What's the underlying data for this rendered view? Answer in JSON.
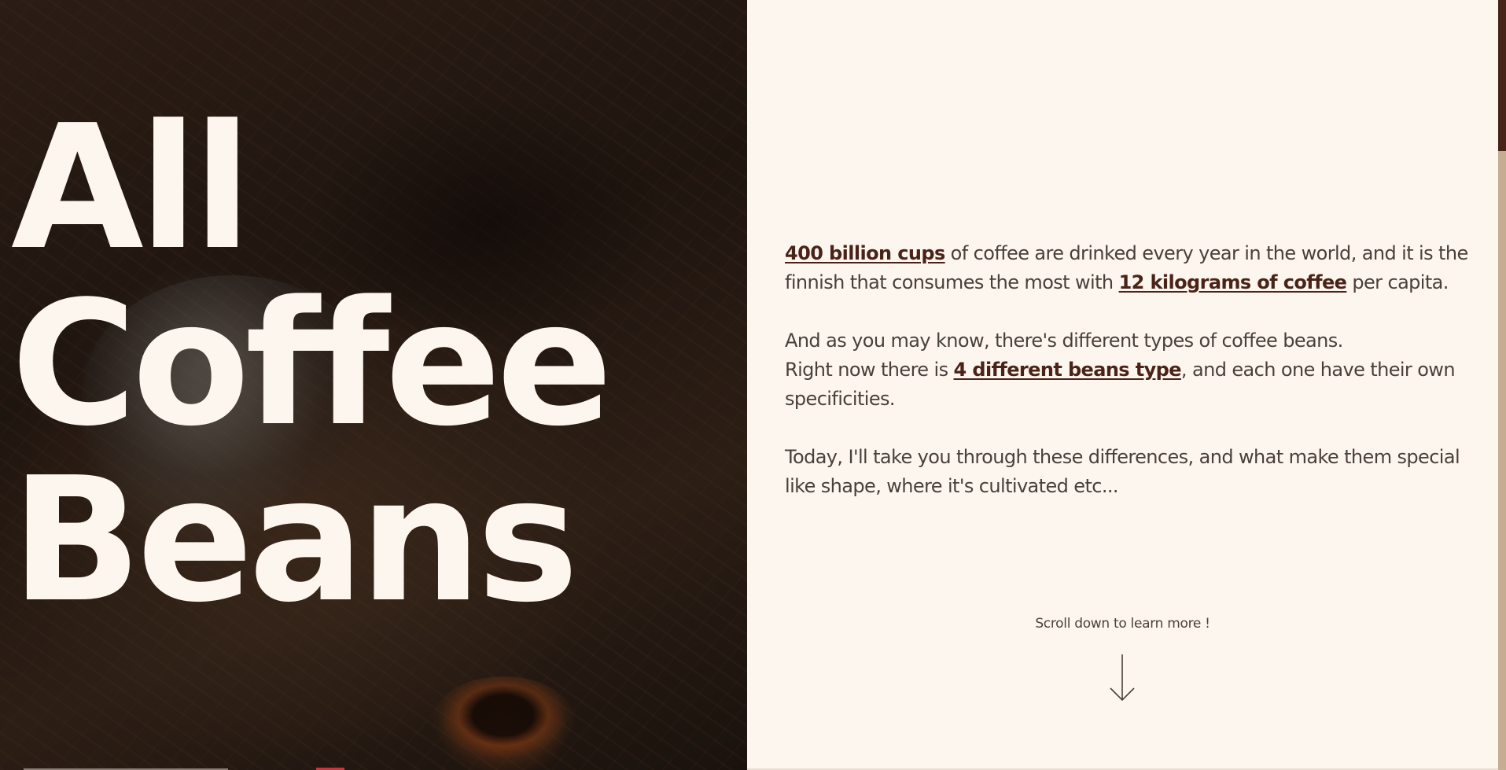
{
  "hero": {
    "title_lines": [
      "All",
      "Coffee",
      "Beans"
    ]
  },
  "intro": {
    "paragraph1": {
      "stat1": "400 billion cups",
      "text1": " of coffee are drinked every year in the world, and it is the finnish that consumes the most with ",
      "stat2": "12 kilograms of coffee",
      "text2": " per capita."
    },
    "paragraph2": {
      "line1": "And as you may know, there's different types of coffee beans.",
      "text1": "Right now there is ",
      "stat": "4 different beans type",
      "text2": ", and each one have their own specificities."
    },
    "paragraph3": {
      "text": "Today, I'll take you through these differences, and what make them special like shape, where it's cultivated etc..."
    }
  },
  "scroll_hint": {
    "label": "Scroll down to learn more !",
    "icon": "arrow-down-icon"
  },
  "colors": {
    "background": "#fdf6ef",
    "text": "#4a3f3a",
    "accent": "#4a2318",
    "hero_text": "#fdf6ef",
    "scrollbar_track": "#c5ad91",
    "scrollbar_thumb": "#4a2318"
  }
}
